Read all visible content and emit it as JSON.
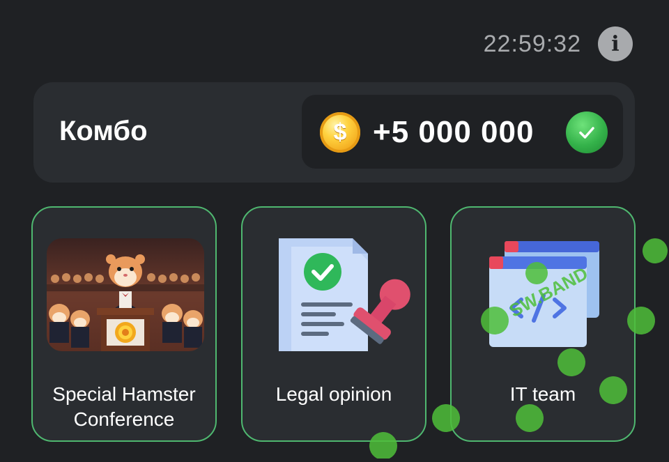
{
  "header": {
    "clock": "22:59:32",
    "info_icon": "info-icon"
  },
  "combo": {
    "title": "Комбо",
    "reward": "+5 000 000",
    "coin_symbol": "$",
    "claimed": true
  },
  "cards": [
    {
      "label": "Special Hamster Conference",
      "image": "hamster-conference-image"
    },
    {
      "label": "Legal opinion",
      "image": "legal-document-stamp-image"
    },
    {
      "label": "IT team",
      "image": "code-window-image"
    }
  ],
  "watermark": {
    "text": "SW.BAND"
  },
  "colors": {
    "background": "#1f2124",
    "panel": "#2a2d31",
    "card_border": "#4fb870",
    "coin": "#ffd23f",
    "check": "#34b24a"
  }
}
